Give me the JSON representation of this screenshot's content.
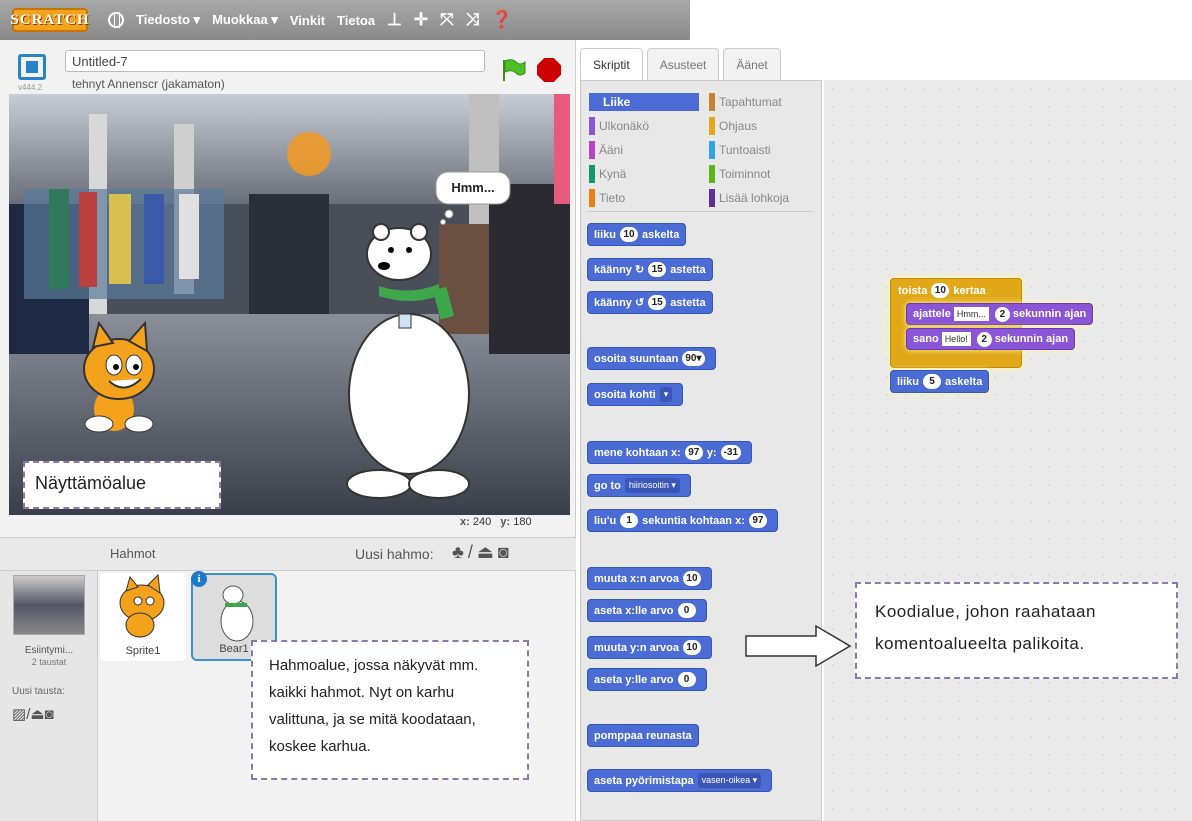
{
  "menu": {
    "logo": "SCRATCH",
    "items": [
      "Tiedosto ▾",
      "Muokkaa ▾",
      "Vinkit",
      "Tietoa"
    ],
    "tools": [
      "⊥",
      "✛",
      "⤧",
      "⤨",
      "❓"
    ]
  },
  "stage_header": {
    "version": "v444.2",
    "project_title": "Untitled-7",
    "author": "tehnyt Annenscr (jakamaton)"
  },
  "stage": {
    "thought": "Hmm...",
    "coords_x_label": "x:",
    "coords_x": "240",
    "coords_y_label": "y:",
    "coords_y": "180",
    "annotation": "Näyttämöalue"
  },
  "sprites": {
    "title": "Hahmot",
    "new_sprite_label": "Uusi hahmo:",
    "stage_name": "Esiintymi...",
    "stage_backdrops": "2 taustat",
    "new_backdrop_label": "Uusi tausta:",
    "items": [
      {
        "name": "Sprite1"
      },
      {
        "name": "Bear1"
      }
    ],
    "annotation": "Hahmoalue, jossa näkyvät mm. kaikki hahmot. Nyt on karhu valittuna, ja se mitä koodataan, koskee karhua."
  },
  "tabs": [
    "Skriptit",
    "Asusteet",
    "Äänet"
  ],
  "categories": [
    {
      "label": "Liike",
      "color": "#4a6cd4"
    },
    {
      "label": "Tapahtumat",
      "color": "#c88330"
    },
    {
      "label": "Ulkonäkö",
      "color": "#8a55d7"
    },
    {
      "label": "Ohjaus",
      "color": "#e1a91a"
    },
    {
      "label": "Ääni",
      "color": "#bb42c3"
    },
    {
      "label": "Tuntoaisti",
      "color": "#2ca5e2"
    },
    {
      "label": "Kynä",
      "color": "#0e9a6c"
    },
    {
      "label": "Toiminnot",
      "color": "#5cb712"
    },
    {
      "label": "Tieto",
      "color": "#ee7d16"
    },
    {
      "label": "Lisää lohkoja",
      "color": "#632d99"
    }
  ],
  "palette": {
    "b1": {
      "a": "liiku",
      "n": "10",
      "b": "askelta"
    },
    "b2": {
      "a": "käänny ↻",
      "n": "15",
      "b": "astetta"
    },
    "b3": {
      "a": "käänny ↺",
      "n": "15",
      "b": "astetta"
    },
    "b4": {
      "a": "osoita suuntaan",
      "n": "90▾"
    },
    "b5": {
      "a": "osoita kohti",
      "d": "▾"
    },
    "b6": {
      "a": "mene kohtaan x:",
      "n": "97",
      "b": "y:",
      "n2": "-31"
    },
    "b7": {
      "a": "go to",
      "d": "hiiriosoitin ▾"
    },
    "b8": {
      "a": "liu'u",
      "n": "1",
      "b": "sekuntia kohtaan x:",
      "n2": "97"
    },
    "b9": {
      "a": "muuta x:n arvoa",
      "n": "10"
    },
    "b10": {
      "a": "aseta x:lle arvo",
      "n": "0"
    },
    "b11": {
      "a": "muuta y:n arvoa",
      "n": "10"
    },
    "b12": {
      "a": "aseta y:lle arvo",
      "n": "0"
    },
    "b13": {
      "a": "pomppaa reunasta"
    },
    "b14": {
      "a": "aseta pyörimistapa",
      "d": "vasen-oikea ▾"
    }
  },
  "script": {
    "repeat_a": "toista",
    "repeat_n": "10",
    "repeat_b": "kertaa",
    "think_a": "ajattele",
    "think_t": "Hmm...",
    "think_n": "2",
    "think_b": "sekunnin ajan",
    "say_a": "sano",
    "say_t": "Hello!",
    "say_n": "2",
    "say_b": "sekunnin ajan",
    "move_a": "liiku",
    "move_n": "5",
    "move_b": "askelta",
    "annotation": "Koodialue, johon raahataan komentoalueelta palikoita."
  }
}
